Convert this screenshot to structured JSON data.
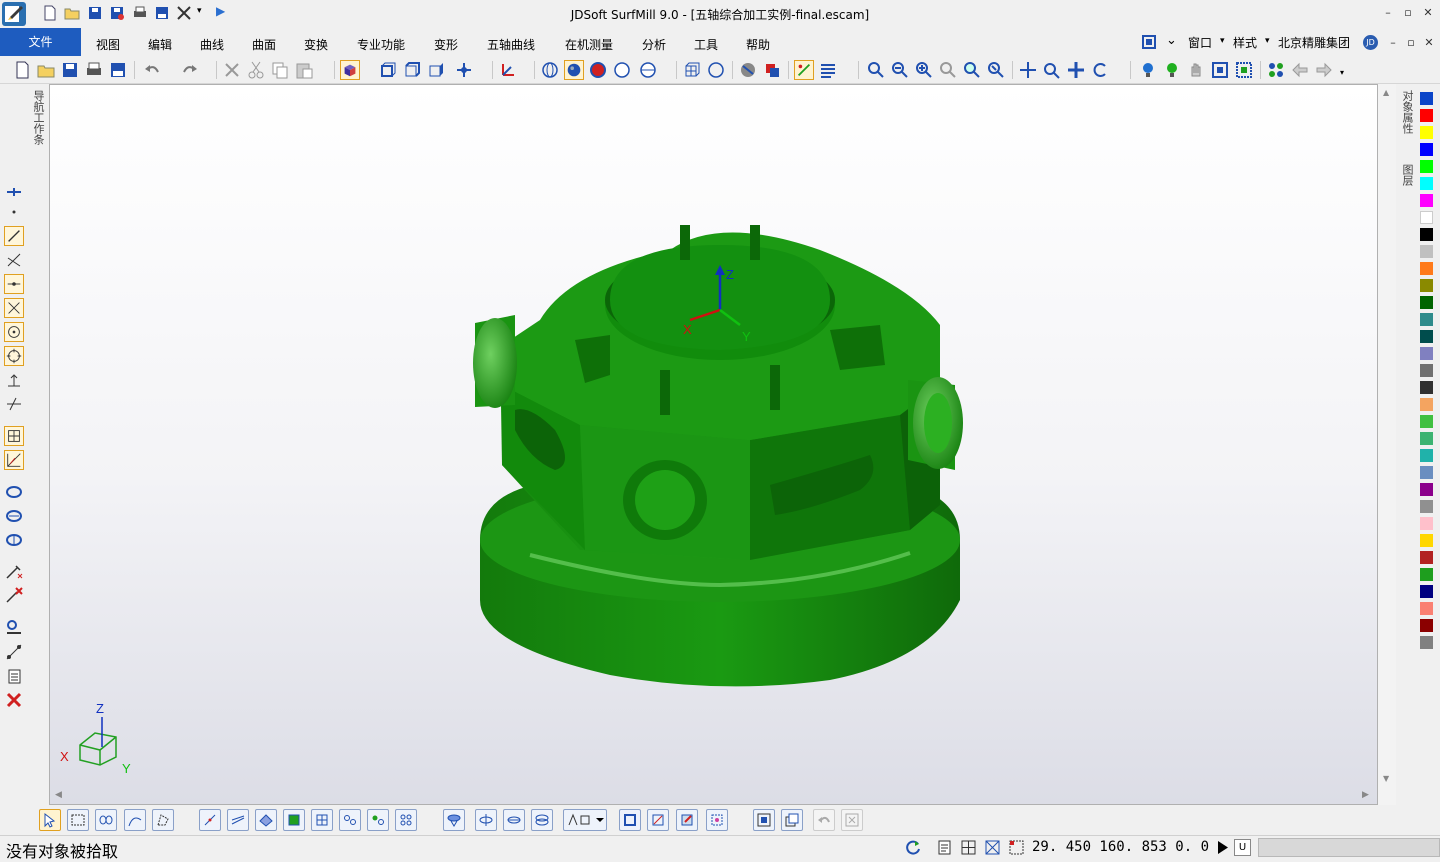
{
  "window": {
    "title": "JDSoft SurfMill 9.0 - [五轴综合加工实例-final.escam]",
    "controls": [
      "–",
      "▫",
      "✕"
    ],
    "inner_controls": [
      "–",
      "▫",
      "✕"
    ]
  },
  "menu": {
    "file": "文件",
    "items": [
      "视图",
      "编辑",
      "曲线",
      "曲面",
      "变换",
      "专业功能",
      "变形",
      "五轴曲线",
      "在机测量",
      "分析",
      "工具",
      "帮助"
    ],
    "right": {
      "window": "窗口",
      "style": "样式",
      "company": "北京精雕集团",
      "avatar": "JD"
    }
  },
  "panels": {
    "left_tab": "导航工作条",
    "right_tab_properties": "对象属性",
    "right_tab_layers": "图层"
  },
  "viewport": {
    "model_color": "#1a8f12",
    "axis_labels": {
      "x": "X",
      "y": "Y",
      "z": "Z"
    },
    "triad_labels": {
      "x": "X",
      "y": "Y",
      "z": "Z"
    }
  },
  "palette": [
    "#0a44c8",
    "#ff0000",
    "#ffff00",
    "#0000ff",
    "#00ff00",
    "#00ffff",
    "#ff00ff",
    "#ffffff",
    "#000000",
    "#c0c0c0",
    "#ff7a1a",
    "#8a8a00",
    "#006400",
    "#2e8b8b",
    "#004d4d",
    "#8080c0",
    "#707070",
    "#303030",
    "#f4a460",
    "#40c040",
    "#3cb371",
    "#20b2aa",
    "#6a8ec0",
    "#8b008b",
    "#909090",
    "#ffc0cb",
    "#ffd700",
    "#b22222",
    "#1e9e1e",
    "#000080",
    "#fa8072",
    "#8b0000",
    "#808080"
  ],
  "status": {
    "message": "没有对象被拾取",
    "coords": "29. 450  160. 853  0. 0",
    "u_label": "U"
  }
}
